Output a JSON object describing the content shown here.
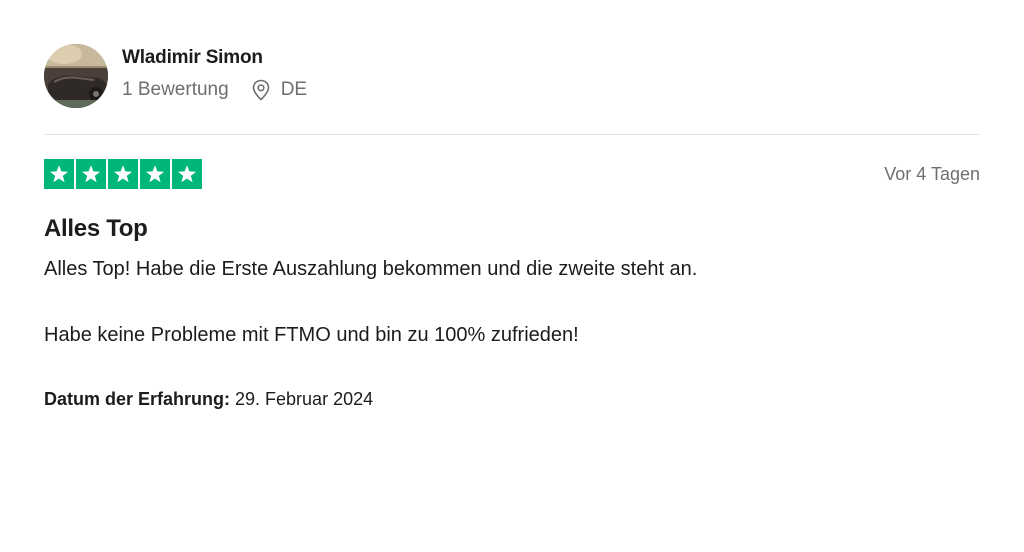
{
  "reviewer": {
    "name": "Wladimir Simon",
    "review_count": "1 Bewertung",
    "country": "DE"
  },
  "review": {
    "rating": 5,
    "max_rating": 5,
    "date_relative": "Vor 4 Tagen",
    "title": "Alles Top",
    "paragraphs": [
      "Alles Top! Habe die Erste Auszahlung bekommen und die zweite steht an.",
      "Habe keine Probleme mit FTMO und bin zu 100% zufrieden!"
    ],
    "experience_label": "Datum der Erfahrung:",
    "experience_date": " 29. Februar 2024"
  },
  "icons": {
    "avatar": "avatar-photo",
    "location": "location-pin-icon",
    "star": "star-icon"
  },
  "colors": {
    "star_fill": "#00b67a",
    "text_primary": "#1c1c1c",
    "text_secondary": "#6f6f6f",
    "divider": "#e5e5dd"
  }
}
